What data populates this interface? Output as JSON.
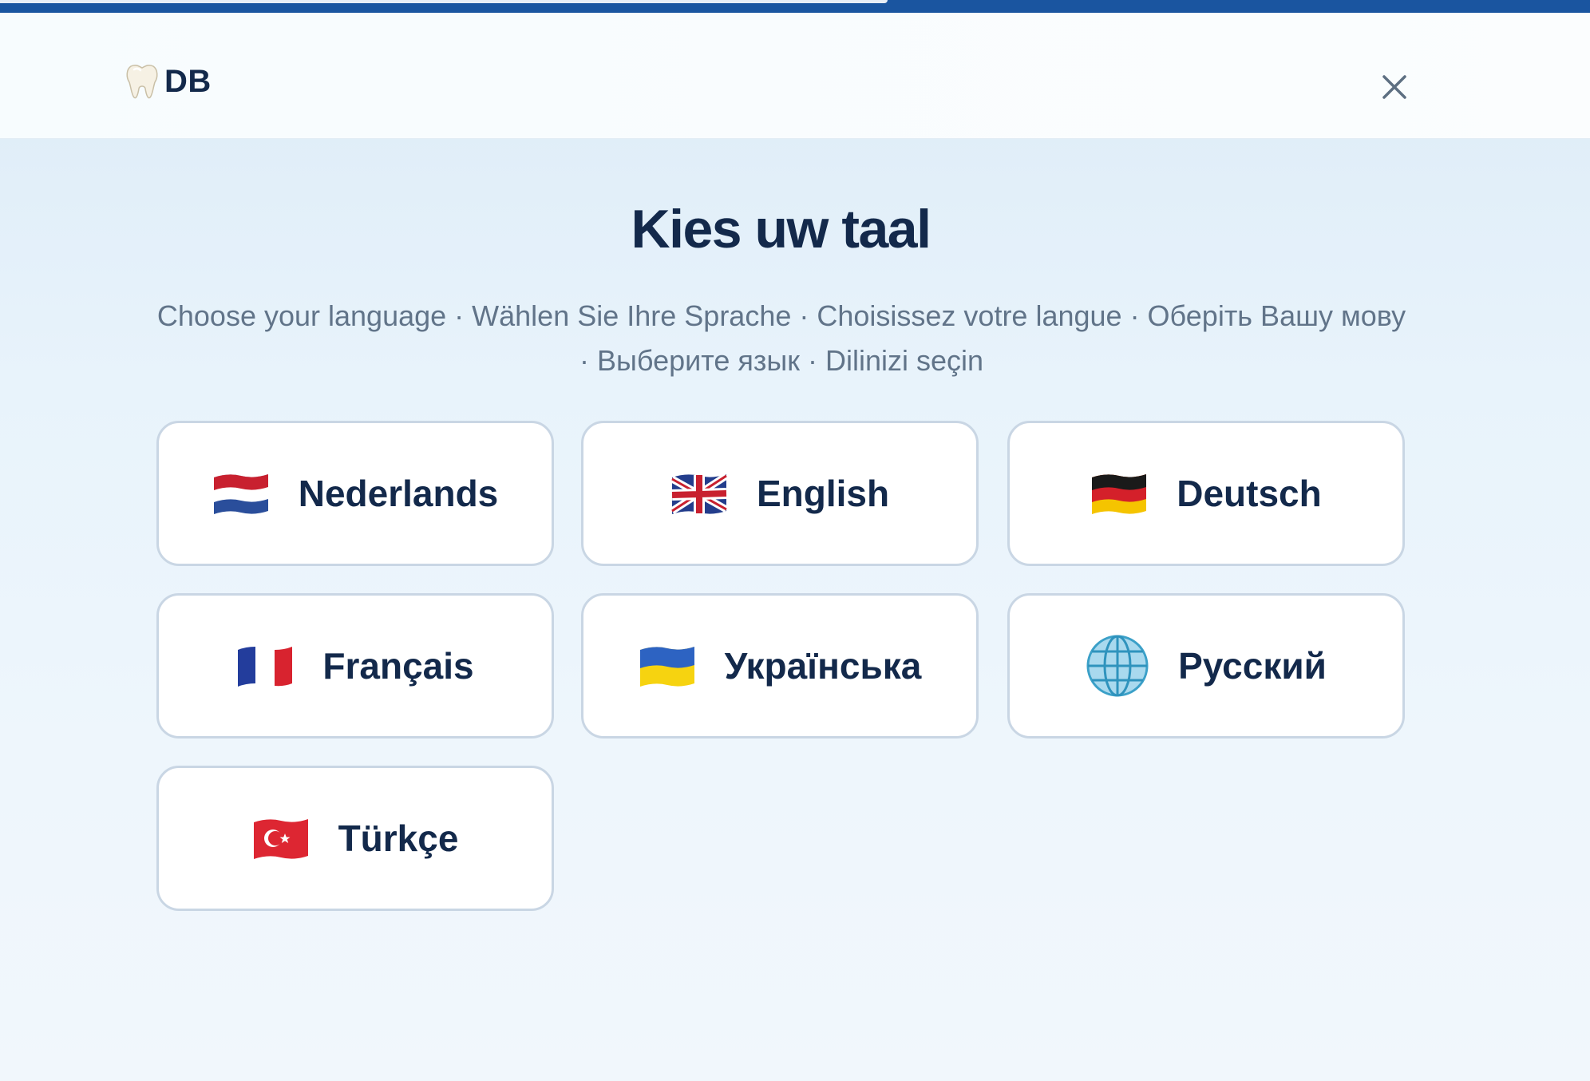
{
  "header": {
    "brand_text": "DB",
    "brand_icon": "tooth-icon",
    "close_icon": "close-icon"
  },
  "main": {
    "title": "Kies uw taal",
    "subtitle": "Choose your language · Wählen Sie Ihre Sprache · Choisissez votre langue · Оберіть Вашу мову · Выберите язык · Dilinizi seçin"
  },
  "languages": [
    {
      "label": "Nederlands",
      "icon": "flag-nl-icon"
    },
    {
      "label": "English",
      "icon": "flag-gb-icon"
    },
    {
      "label": "Deutsch",
      "icon": "flag-de-icon"
    },
    {
      "label": "Français",
      "icon": "flag-fr-icon"
    },
    {
      "label": "Українська",
      "icon": "flag-ua-icon"
    },
    {
      "label": "Русский",
      "icon": "globe-icon"
    },
    {
      "label": "Türkçe",
      "icon": "flag-tr-icon"
    }
  ],
  "colors": {
    "top_bar": "#1a55a0",
    "text_dark": "#13294b",
    "text_muted": "#617489",
    "card_border": "#c9d6e4"
  }
}
